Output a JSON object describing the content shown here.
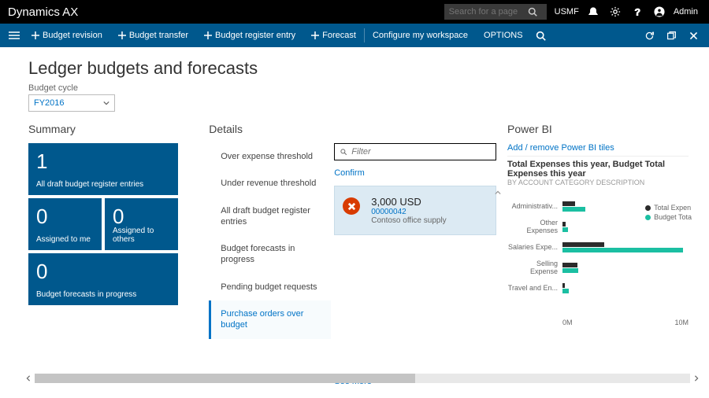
{
  "topbar": {
    "brand": "Dynamics AX",
    "search_placeholder": "Search for a page",
    "company": "USMF",
    "admin": "Admin"
  },
  "actionbar": {
    "items": [
      {
        "label": "Budget revision"
      },
      {
        "label": "Budget transfer"
      },
      {
        "label": "Budget register entry"
      },
      {
        "label": "Forecast"
      }
    ],
    "configure": "Configure my workspace",
    "options": "OPTIONS"
  },
  "page": {
    "title": "Ledger budgets and forecasts",
    "budget_cycle_label": "Budget cycle",
    "budget_cycle_value": "FY2016"
  },
  "summary": {
    "title": "Summary",
    "tiles": [
      {
        "value": "1",
        "label": "All draft budget register entries"
      },
      {
        "value": "0",
        "label": "Assigned to me"
      },
      {
        "value": "0",
        "label": "Assigned to others"
      },
      {
        "value": "0",
        "label": "Budget forecasts in progress"
      }
    ]
  },
  "details": {
    "title": "Details",
    "tabs": [
      "Over expense threshold",
      "Under revenue threshold",
      "All draft budget register entries",
      "Budget forecasts in progress",
      "Pending budget requests",
      "Purchase orders over budget"
    ],
    "filter_placeholder": "Filter",
    "confirm": "Confirm",
    "card": {
      "amount": "3,000 USD",
      "number": "00000042",
      "vendor": "Contoso office supply"
    },
    "see_more": "See more"
  },
  "powerbi": {
    "title": "Power BI",
    "add_remove": "Add / remove Power BI tiles",
    "chart_title": "Total Expenses this year, Budget Total Expenses this year",
    "chart_sub": "BY ACCOUNT CATEGORY DESCRIPTION",
    "legend": {
      "exp": "Total Expen",
      "bud": "Budget Tota"
    }
  },
  "chart_data": {
    "type": "bar",
    "orientation": "horizontal",
    "categories": [
      "Administrativ...",
      "Other Expenses",
      "Salaries Expe...",
      "Selling Expense",
      "Travel and En..."
    ],
    "series": [
      {
        "name": "Total Expenses",
        "values": [
          1.2,
          0.3,
          4.0,
          1.4,
          0.2
        ]
      },
      {
        "name": "Budget Total Expenses",
        "values": [
          2.2,
          0.5,
          11.5,
          1.5,
          0.6
        ]
      }
    ],
    "xlabel": "",
    "ylabel": "",
    "x_ticks": [
      "0M",
      "10M"
    ],
    "xlim": [
      0,
      12
    ]
  }
}
